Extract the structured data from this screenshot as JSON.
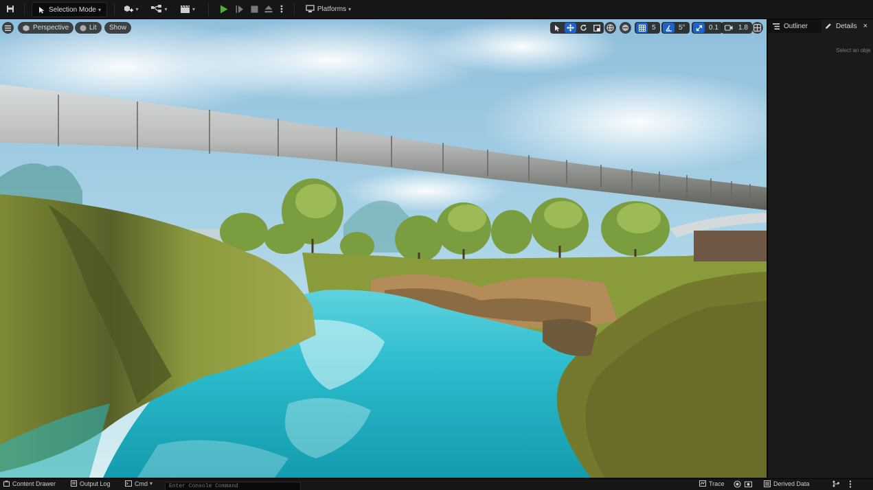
{
  "toolbar": {
    "selection_mode": "Selection Mode",
    "platforms": "Platforms"
  },
  "viewport": {
    "view_mode": "Perspective",
    "lit_mode": "Lit",
    "show": "Show",
    "grid_snap": "5",
    "rotation_snap": "5°",
    "scale_snap": "0.1",
    "camera_speed": "1.8"
  },
  "panel": {
    "outliner_tab": "Outliner",
    "details_tab": "Details",
    "details_hint": "Select an obje"
  },
  "bottombar": {
    "content_drawer": "Content Drawer",
    "output_log": "Output Log",
    "cmd": "Cmd",
    "console_placeholder": "Enter Console Command",
    "trace": "Trace",
    "derived_data": "Derived Data"
  },
  "colors": {
    "accent_blue": "#1d63c9",
    "play_green": "#4caf32",
    "water": "#2bb6c7",
    "grass": "#8e9a3a"
  }
}
